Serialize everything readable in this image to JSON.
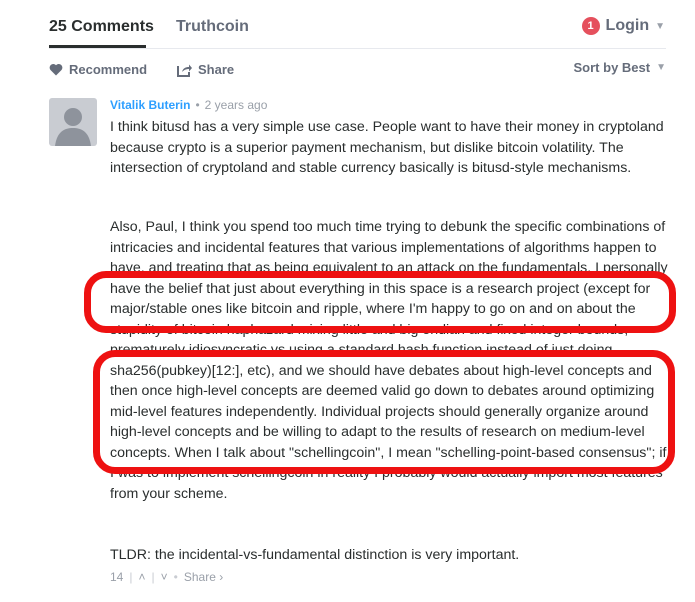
{
  "nav": {
    "comments_tab": "25 Comments",
    "community_tab": "Truthcoin",
    "login_badge": "1",
    "login_label": "Login"
  },
  "actions": {
    "recommend": "Recommend",
    "share": "Share",
    "sort": "Sort by Best"
  },
  "comment": {
    "author": "Vitalik Buterin",
    "time": "2 years ago",
    "paragraphs": [
      "I think bitusd has a very simple use case. People want to have their money in cryptoland because crypto is a superior payment mechanism, but dislike bitcoin volatility. The intersection of cryptoland and stable currency basically is bitusd-style mechanisms.",
      "Also, Paul, I think you spend too much time trying to debunk the specific combinations of intricacies and incidental features that various implementations of algorithms happen to have, and treating that as being equivalent to an attack on the fundamentals. I personally have the belief that just about everything in this space is a research project (except for major/stable ones like bitcoin and ripple, where I'm happy to go on and on about the stupidity of bitcoin haphazard mixing little and big endian and fixed integer bounds, prematurely idiosyncratic vs using a standard hash function instead of just doing sha256(pubkey)[12:], etc), and we should have debates about high-level concepts and then once high-level concepts are deemed valid go down to debates around optimizing mid-level features independently. Individual projects should generally organize around high-level concepts and be willing to adapt to the results of research on medium-level concepts. When I talk about \"schellingcoin\", I mean \"schelling-point-based consensus\"; if I was to implement schellingcoin in reality I probably would actually import most features from your scheme.",
      "TLDR: the incidental-vs-fundamental distinction is very important."
    ],
    "votes": "14",
    "share_link": "Share ›"
  },
  "highlight_color": "#ee1111",
  "link_color": "#2e9fff"
}
